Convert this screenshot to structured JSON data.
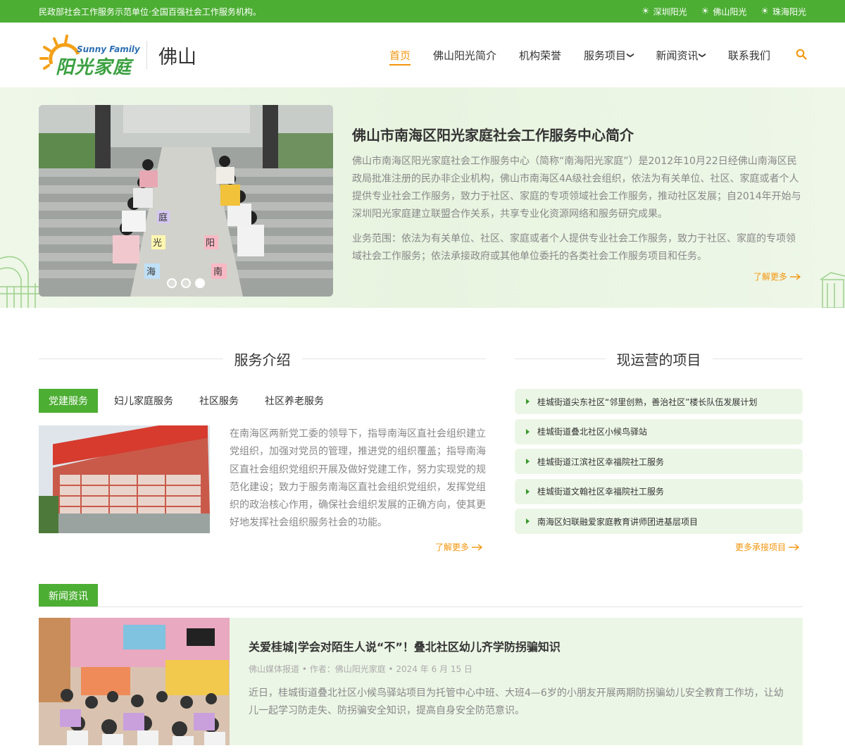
{
  "topbar": {
    "tagline": "民政部社会工作服务示范单位·全国百强社会工作服务机构。",
    "sites": [
      {
        "label": "深圳阳光"
      },
      {
        "label": "佛山阳光"
      },
      {
        "label": "珠海阳光"
      }
    ]
  },
  "logo": {
    "english": "Sunny Family",
    "chinese": "阳光家庭",
    "city": "佛山"
  },
  "nav": {
    "items": [
      {
        "label": "首页",
        "active": true
      },
      {
        "label": "佛山阳光简介"
      },
      {
        "label": "机构荣誉"
      },
      {
        "label": "服务项目"
      },
      {
        "label": "新闻资讯"
      },
      {
        "label": "联系我们"
      }
    ],
    "search_icon": "search-icon"
  },
  "hero": {
    "title": "佛山市南海区阳光家庭社会工作服务中心简介",
    "paragraph1": "佛山市南海区阳光家庭社会工作服务中心（简称“南海阳光家庭”）是2012年10月22日经佛山南海区民政局批准注册的民办非企业机构，佛山市南海区4A级社会组织，依法为有关单位、社区、家庭或者个人提供专业社会工作服务，致力于社区、家庭的专项领域社会工作服务，推动社区发展；自2014年开始与深圳阳光家庭建立联盟合作关系，共享专业化资源网络和服务研究成果。",
    "paragraph2": "业务范围：依法为有关单位、社区、家庭或者个人提供专业社会工作服务，致力于社区、家庭的专项领域社会工作服务；依法承接政府或其他单位委托的各类社会工作服务项目和任务。",
    "more": "了解更多",
    "slide_count": 3,
    "active_slide": 3
  },
  "services": {
    "title": "服务介绍",
    "tabs": [
      {
        "label": "党建服务",
        "active": true
      },
      {
        "label": "妇儿家庭服务"
      },
      {
        "label": "社区服务"
      },
      {
        "label": "社区养老服务"
      }
    ],
    "description": "在南海区两新党工委的领导下，指导南海区直社会组织建立党组织，加强对党员的管理，推进党的组织覆盖；指导南海区直社会组织党组织开展及做好党建工作，努力实现党的规范化建设；致力于服务南海区直社会组织党组织，发挥党组织的政治核心作用，确保社会组织发展的正确方向，使其更好地发挥社会组织服务社会的功能。",
    "more": "了解更多"
  },
  "projects": {
    "title": "现运营的项目",
    "items": [
      {
        "label": "桂城街道尖东社区“邻里创熟，善治社区”楼长队伍发展计划"
      },
      {
        "label": "桂城街道叠北社区小候鸟驿站"
      },
      {
        "label": "桂城街道江滨社区幸福院社工服务"
      },
      {
        "label": "桂城街道文翰社区幸福院社工服务"
      },
      {
        "label": "南海区妇联融爱家庭教育讲师团进基层项目"
      }
    ],
    "more": "更多承接项目"
  },
  "news": {
    "tab": "新闻资讯",
    "article": {
      "title": "关爱桂城|学会对陌生人说“不”！叠北社区幼儿齐学防拐骗知识",
      "meta": "佛山媒体报道 • 作者：佛山阳光家庭 • 2024 年 6 月 15 日",
      "summary": "近日，桂城街道叠北社区小候鸟驿站项目为托管中心中班、大班4—6岁的小朋友开展两期防拐骗幼儿安全教育工作坊，让幼儿一起学习防走失、防拐骗安全知识，提高自身安全防范意识。"
    }
  },
  "colors": {
    "brand_green": "#4cae33",
    "accent_orange": "#f3950c",
    "light_green_bg": "#ecf6e6"
  }
}
